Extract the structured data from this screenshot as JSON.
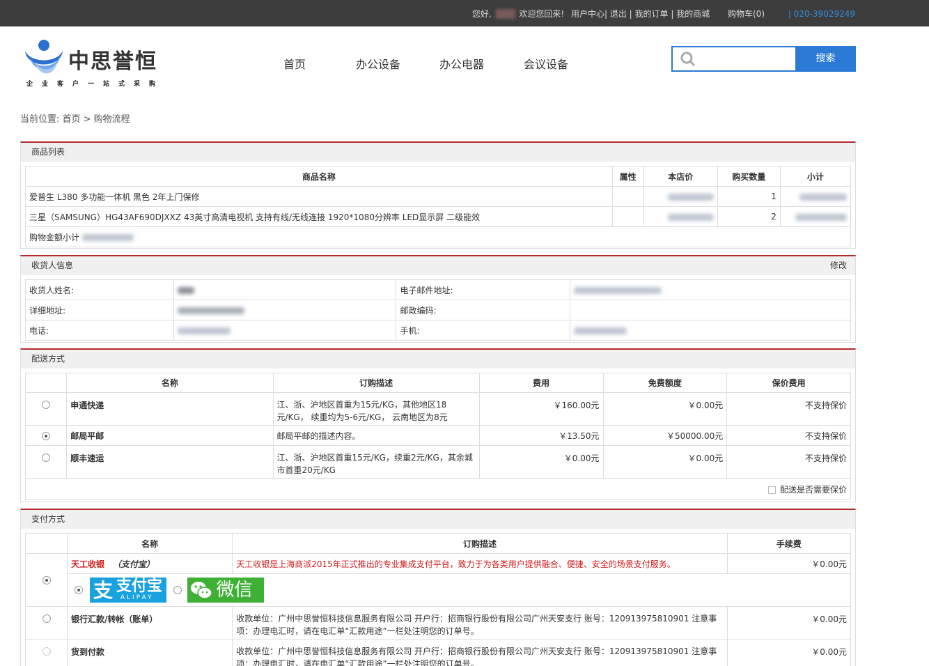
{
  "topbar": {
    "greeting": "您好,",
    "welcome": "欢迎您回来!",
    "links": "用户中心| 退出 | 我的订单 | 我的商城",
    "cart": "购物车(0)",
    "phone": "| 020-39029249"
  },
  "logo": {
    "brand": "中思誉恒",
    "slogan": "企业客户一站式采购"
  },
  "nav": [
    "首页",
    "办公设备",
    "办公电器",
    "会议设备"
  ],
  "search": {
    "placeholder": "",
    "button": "搜索"
  },
  "breadcrumb": "当前位置: 首页 > 购物流程",
  "goods": {
    "title": "商品列表",
    "headers": [
      "商品名称",
      "属性",
      "本店价",
      "购买数量",
      "小计"
    ],
    "rows": [
      {
        "name": "爱普生 L380 多功能一体机 黑色 2年上门保修",
        "qty": "1"
      },
      {
        "name": "三星（SAMSUNG）HG43AF690DJXXZ 43英寸高清电视机 支持有线/无线连接 1920*1080分辨率 LED显示屏 二级能效",
        "qty": "2"
      }
    ],
    "total_label": "购物金额小计"
  },
  "consignee": {
    "title": "收货人信息",
    "edit": "修改",
    "labels": {
      "name": "收货人姓名:",
      "email": "电子邮件地址:",
      "address": "详细地址:",
      "zip": "邮政编码:",
      "tel": "电话:",
      "mobile": "手机:"
    }
  },
  "shipping": {
    "title": "配送方式",
    "headers": [
      "名称",
      "订购描述",
      "费用",
      "免费额度",
      "保价费用"
    ],
    "rows": [
      {
        "name": "申通快递",
        "desc": "江、浙、沪地区首重为15元/KG，其他地区18元/KG， 续重均为5-6元/KG， 云南地区为8元",
        "fee": "￥160.00元",
        "free": "￥0.00元",
        "insure": "不支持保价",
        "selected": false
      },
      {
        "name": "邮局平邮",
        "desc": "邮局平邮的描述内容。",
        "fee": "￥13.50元",
        "free": "￥50000.00元",
        "insure": "不支持保价",
        "selected": true
      },
      {
        "name": "顺丰速运",
        "desc": "江、浙、沪地区首重15元/KG，续重2元/KG，其余城市首重20元/KG",
        "fee": "￥0.00元",
        "free": "￥0.00元",
        "insure": "不支持保价",
        "selected": false
      }
    ],
    "insure_label": "配送是否需要保价"
  },
  "payment": {
    "title": "支付方式",
    "headers": [
      "名称",
      "订购描述",
      "手续费"
    ],
    "rows": [
      {
        "name": "天工收银",
        "sub": "（支付宝）",
        "desc": "天工收银是上海商派2015年正式推出的专业集成支付平台，致力于为各类用户提供融合、便捷、安全的场景支付服务。",
        "fee": "￥0.00元",
        "selected": true
      },
      {
        "name": "银行汇款/转帐（账单）",
        "desc": "收款单位：广州中思誉恒科技信息服务有限公司 开户行：招商银行股份有限公司广州天安支行 账号：120913975810901 注意事项：办理电汇时，请在电汇单“汇款用途”一栏处注明您的订单号。",
        "fee": "￥0.00元",
        "selected": false
      },
      {
        "name": "货到付款",
        "desc": "收款单位：广州中思誉恒科技信息服务有限公司 开户行：招商银行股份有限公司广州天安支行 账号：120913975810901 注意事项：办理电汇时，请在电汇单“汇款用途”一栏处注明您的订单号。",
        "fee": "￥0.00元",
        "selected": false
      }
    ],
    "alipay_label": "支付宝",
    "alipay_sub": "ALIPAY",
    "wechat_label": "微信"
  }
}
